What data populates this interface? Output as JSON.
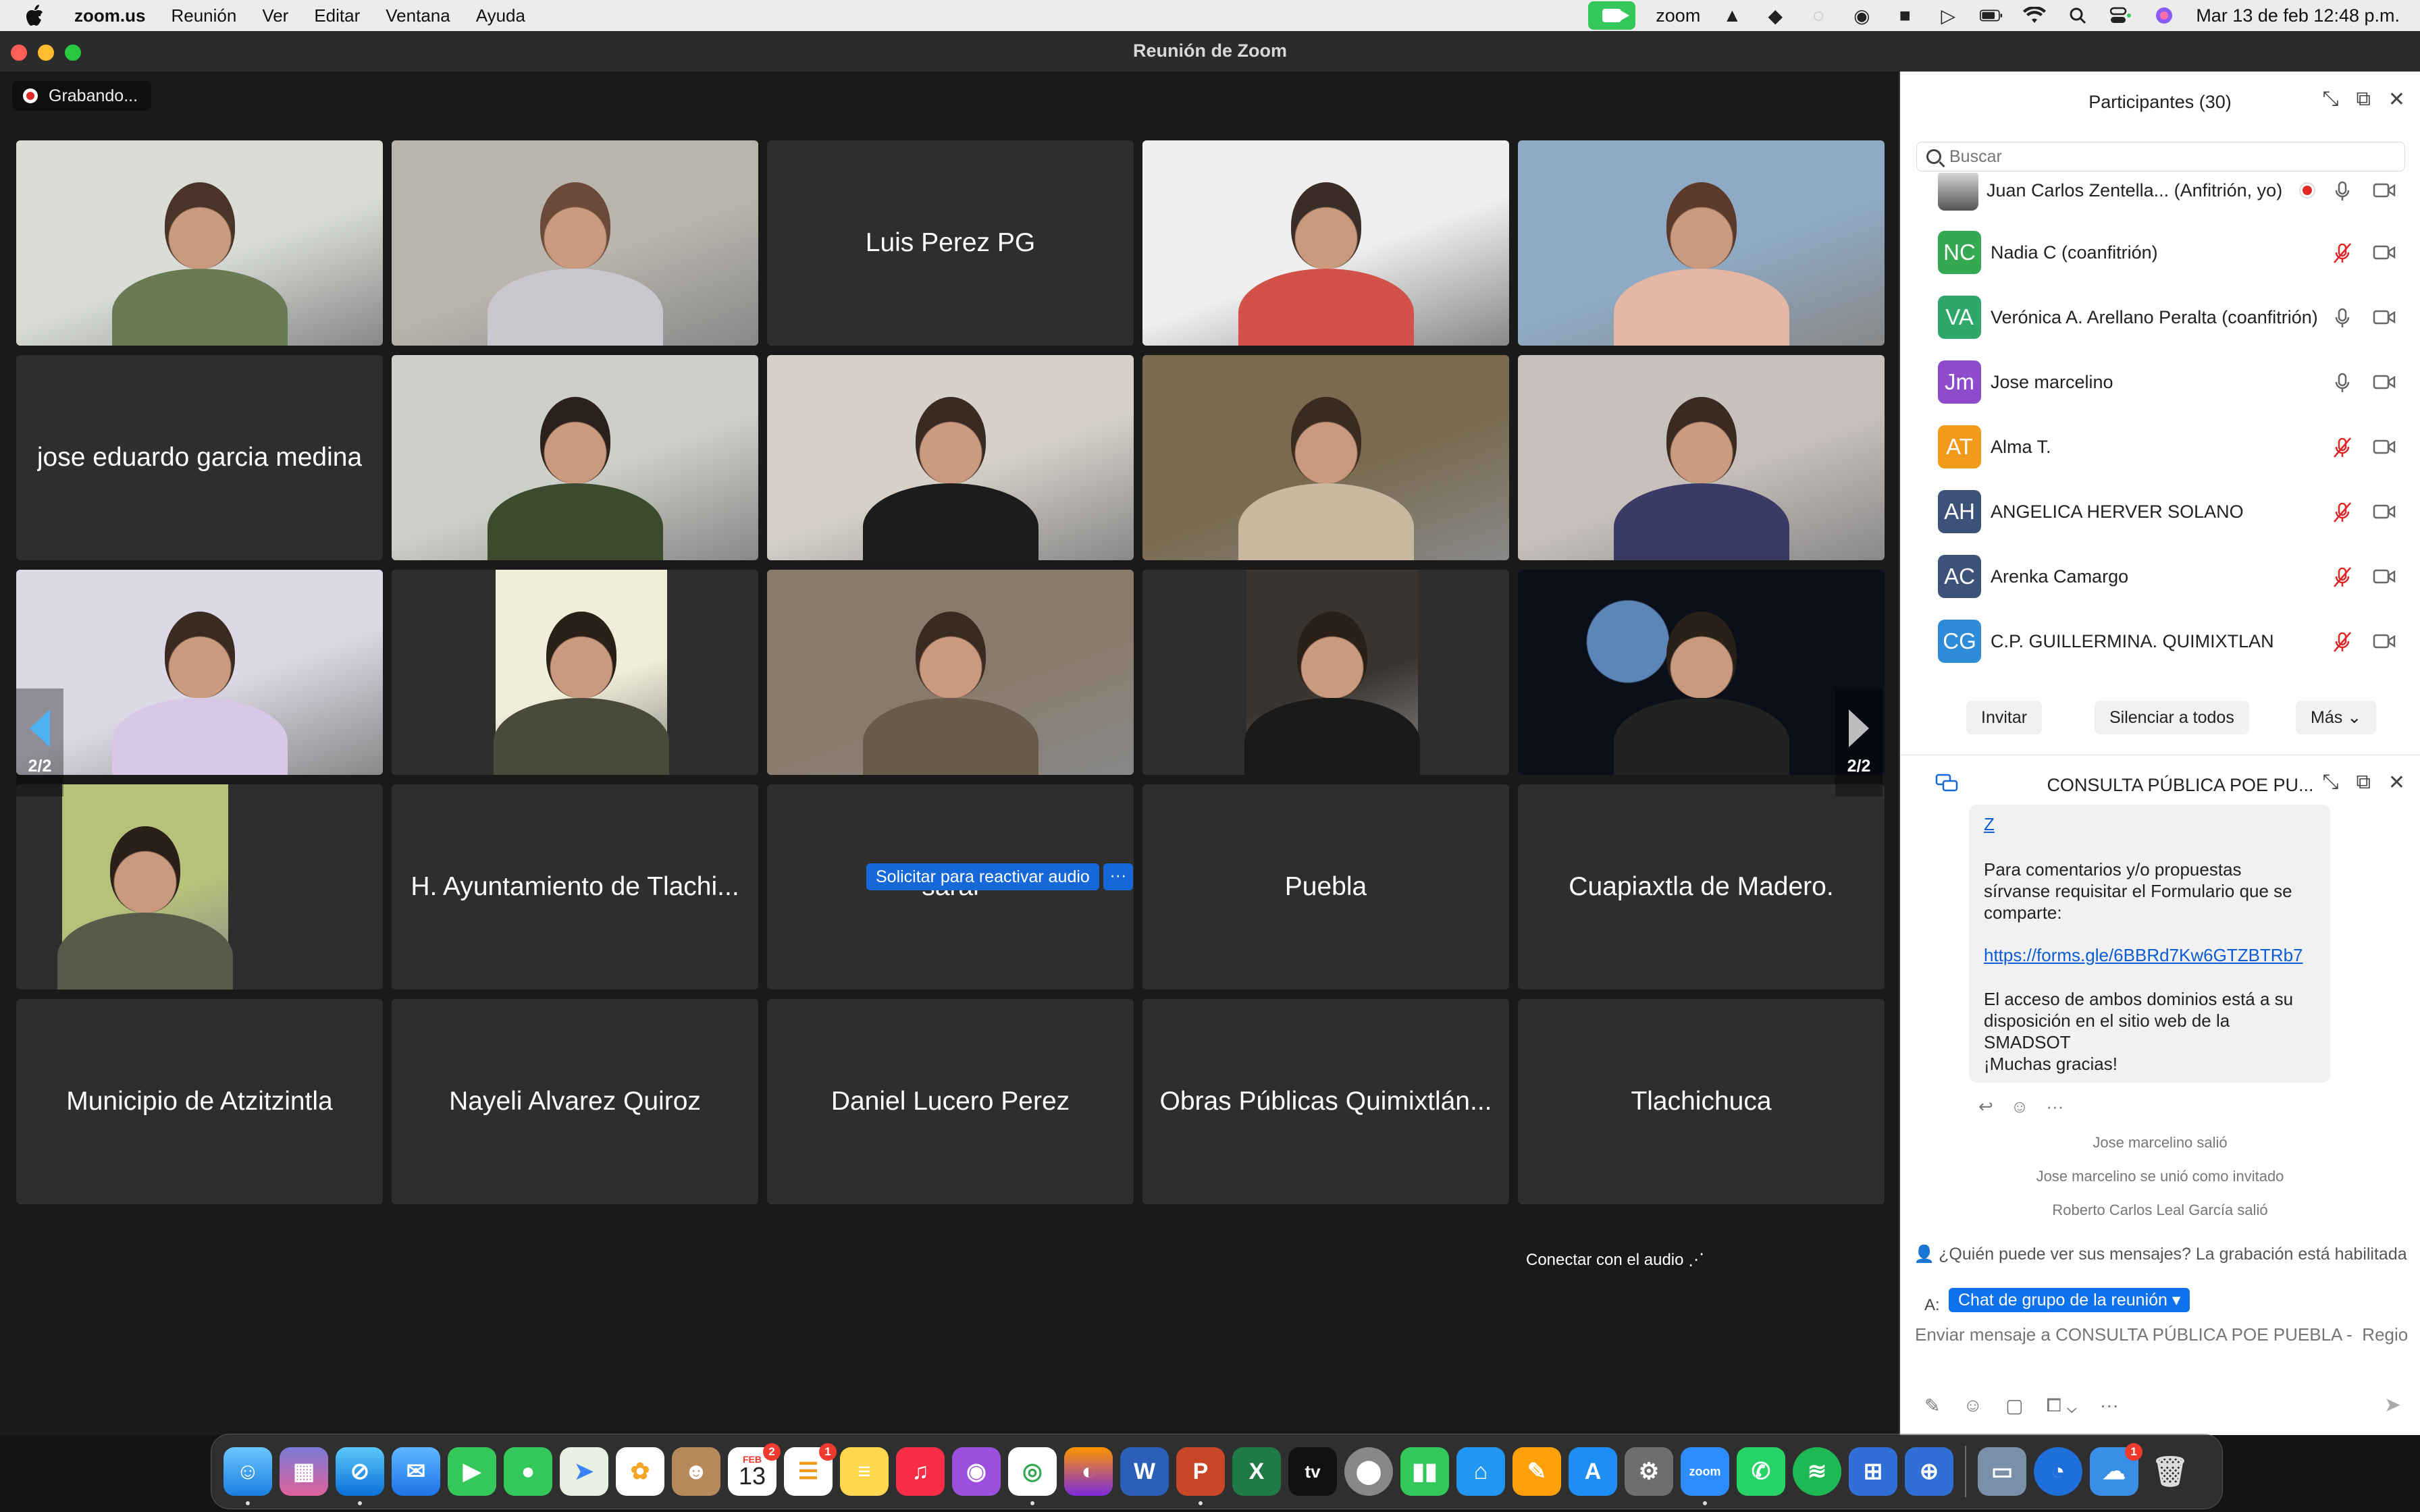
{
  "menubar": {
    "app_name": "zoom.us",
    "items": [
      "Reunión",
      "Ver",
      "Editar",
      "Ventana",
      "Ayuda"
    ],
    "zoom_label": "zoom",
    "datetime": "Mar 13 de feb  12:48 p.m."
  },
  "window": {
    "title": "Reunión de Zoom"
  },
  "meeting": {
    "recording_label": "Grabando...",
    "page_indicator": "2/2",
    "tiles": [
      {
        "type": "video",
        "name": ""
      },
      {
        "type": "video",
        "name": ""
      },
      {
        "type": "name",
        "name": "Luis Perez PG"
      },
      {
        "type": "video",
        "name": ""
      },
      {
        "type": "video",
        "name": ""
      },
      {
        "type": "name",
        "name": "jose eduardo garcia medina"
      },
      {
        "type": "video",
        "name": ""
      },
      {
        "type": "video",
        "name": ""
      },
      {
        "type": "video",
        "name": ""
      },
      {
        "type": "video",
        "name": ""
      },
      {
        "type": "video",
        "name": ""
      },
      {
        "type": "video",
        "name": ""
      },
      {
        "type": "video",
        "name": ""
      },
      {
        "type": "video",
        "name": ""
      },
      {
        "type": "video",
        "name": ""
      },
      {
        "type": "video",
        "name": ""
      },
      {
        "type": "name",
        "name": "H. Ayuntamiento de Tlachi..."
      },
      {
        "type": "name",
        "name": "sarai"
      },
      {
        "type": "name",
        "name": "Puebla"
      },
      {
        "type": "name",
        "name": "Cuapiaxtla de Madero."
      },
      {
        "type": "name",
        "name": "Municipio de Atzitzintla"
      },
      {
        "type": "name",
        "name": "Nayeli Alvarez Quiroz"
      },
      {
        "type": "name",
        "name": "Daniel Lucero Perez"
      },
      {
        "type": "name",
        "name": "Obras Públicas Quimixtlán..."
      },
      {
        "type": "name",
        "name": "Tlachichuca"
      }
    ],
    "unmute_request": "Solicitar para reactivar audio",
    "unmute_more": "···",
    "connect_audio": "Conectar con el audio  ⋰"
  },
  "participants": {
    "title": "Participantes (30)",
    "search_placeholder": "Buscar",
    "list": [
      {
        "initials": "",
        "name": "Juan Carlos Zentella...  (Anfitrión, yo)",
        "color": "#777",
        "muted": false,
        "recording": true,
        "photo": true
      },
      {
        "initials": "NC",
        "name": "Nadia C (coanfitrión)",
        "color": "#35a853",
        "muted": true
      },
      {
        "initials": "VA",
        "name": "Verónica A. Arellano Peralta (coanfitrión)",
        "color": "#30a76a",
        "muted": false
      },
      {
        "initials": "Jm",
        "name": "Jose marcelino",
        "color": "#8e4bcc",
        "muted": false
      },
      {
        "initials": "AT",
        "name": "Alma T.",
        "color": "#f29a1c",
        "muted": true
      },
      {
        "initials": "AH",
        "name": "ANGELICA HERVER SOLANO",
        "color": "#3c5278",
        "muted": true
      },
      {
        "initials": "AC",
        "name": "Arenka Camargo",
        "color": "#3c5278",
        "muted": true
      },
      {
        "initials": "CG",
        "name": "C.P. GUILLERMINA. QUIMIXTLAN",
        "color": "#2e8bd8",
        "muted": true
      }
    ],
    "invite": "Invitar",
    "mute_all": "Silenciar a todos",
    "more": "Más"
  },
  "chat": {
    "title": "CONSULTA PÚBLICA POE PU...",
    "prev_link_tail": "Z",
    "message_intro": "Para comentarios y/o propuestas\nsírvanse requisitar el Formulario que se\ncomparte:",
    "form_link": "https://forms.gle/6BBRd7Kw6GTZBTRb7",
    "message_outro": "El acceso de ambos dominios está a su\ndisposición en el sitio web de la\nSMADSOT\n¡Muchas gracias!",
    "system_messages": [
      "Jose marcelino salió",
      "Jose marcelino se unió como invitado",
      "Roberto Carlos Leal García salió"
    ],
    "visibility_notice": "¿Quién puede ver sus mensajes? La grabación está habilitada",
    "to_label": "A:",
    "recipient": "Chat de grupo de la reunión ▾",
    "input_placeholder": "Enviar mensaje a CONSULTA PÚBLICA POE PUEBLA -  Regio..."
  },
  "dock": {
    "calendar_month": "FEB",
    "calendar_day": "13",
    "calendar_badge": "2",
    "reminders_badge": "1",
    "zoom_label": "zoom",
    "tv_label": "tv",
    "last_badge": "1"
  }
}
